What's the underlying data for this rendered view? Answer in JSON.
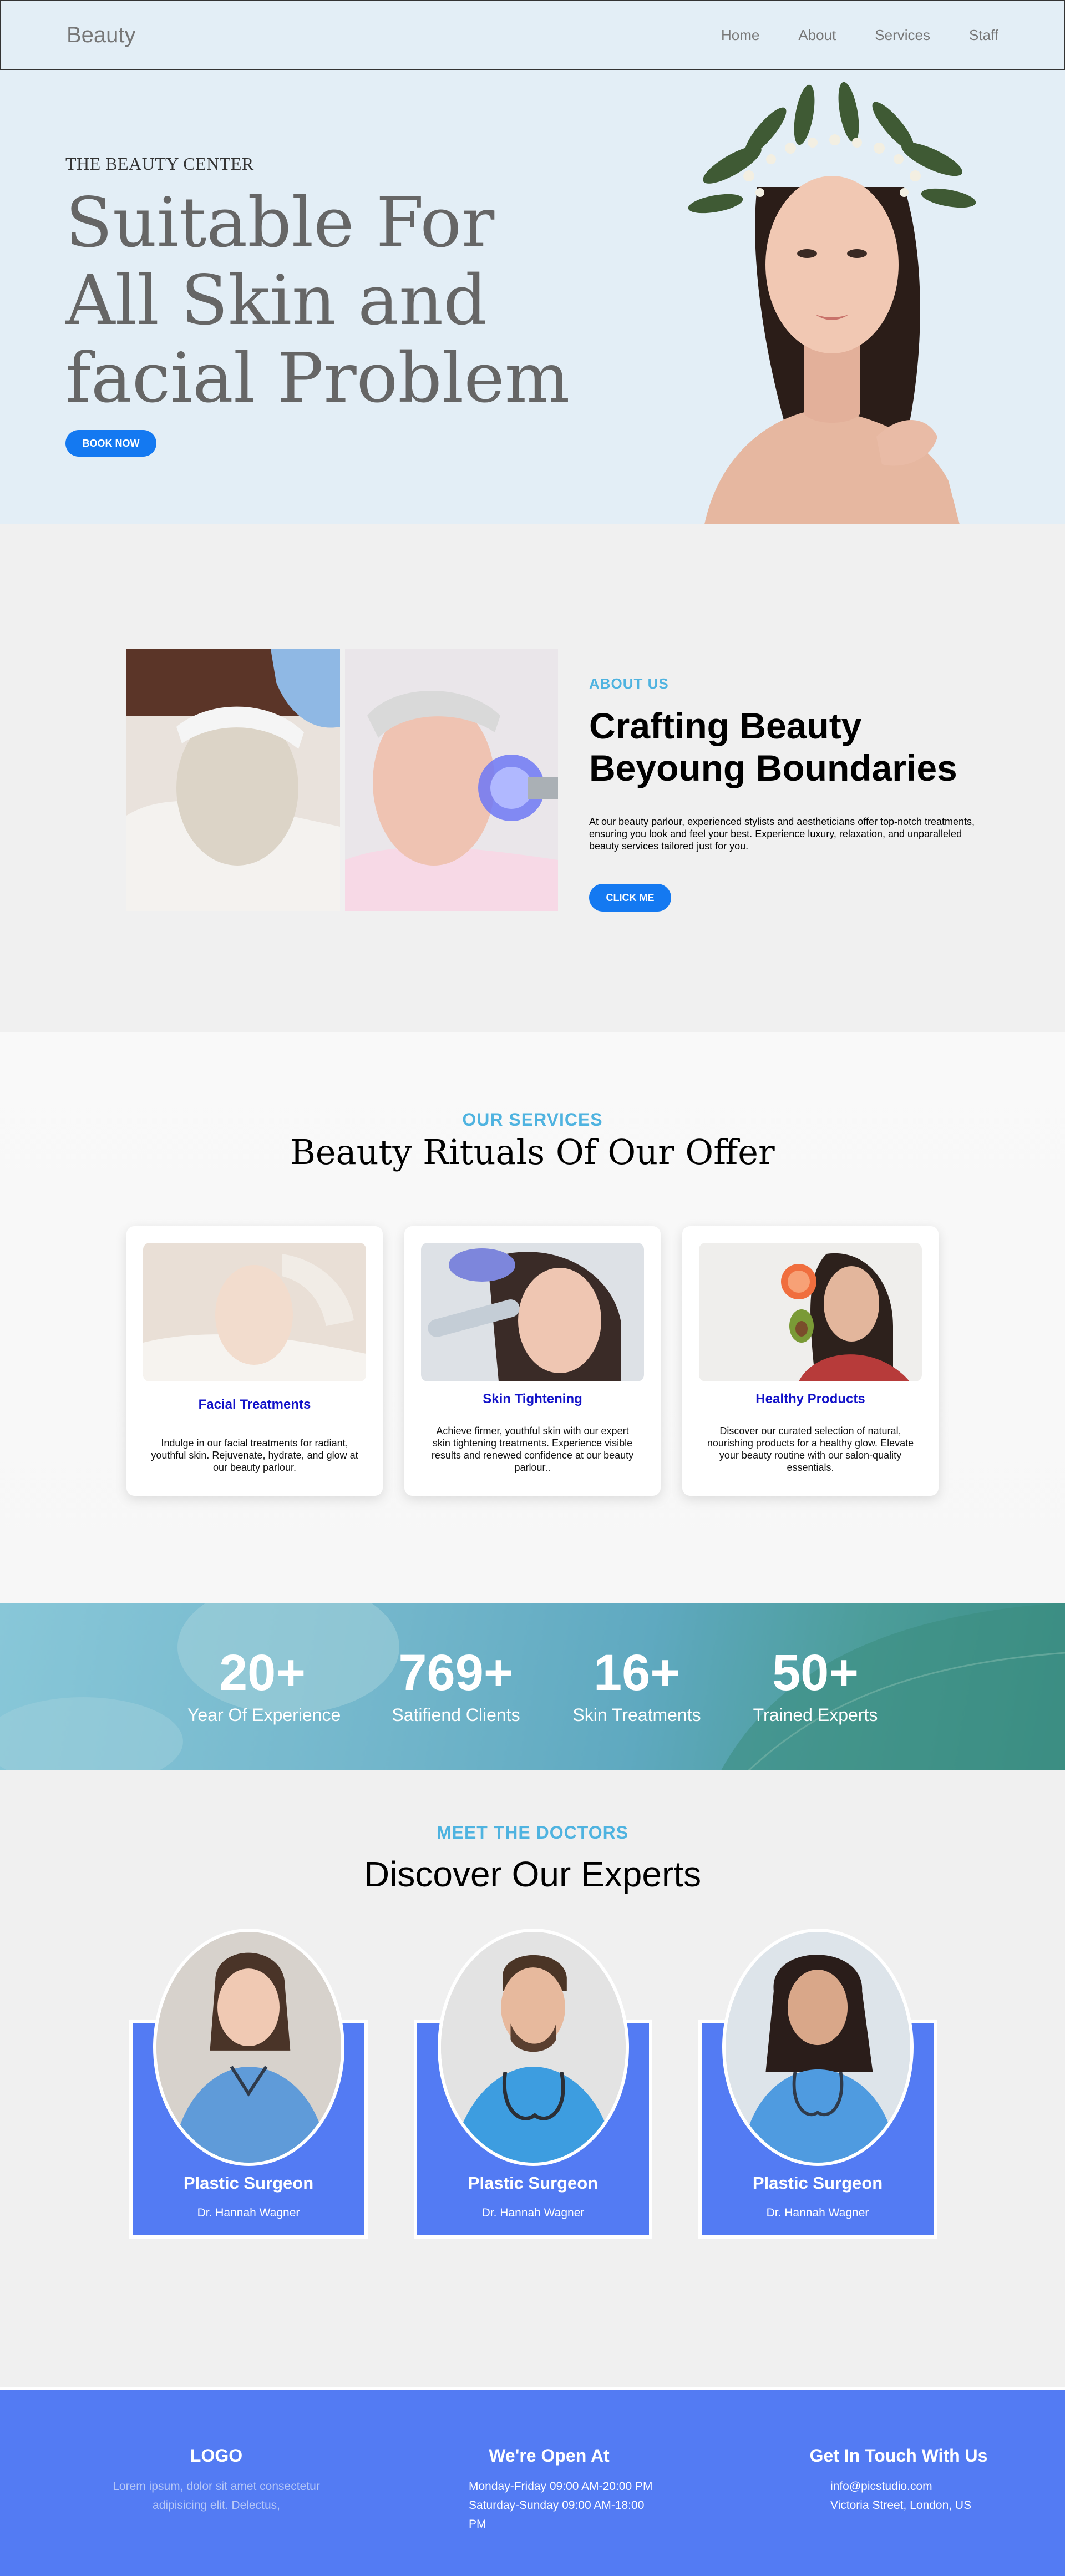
{
  "nav": {
    "brand": "Beauty",
    "links": [
      "Home",
      "About",
      "Services",
      "Staff"
    ]
  },
  "hero": {
    "kicker": "THE BEAUTY CENTER",
    "title": "Suitable For All Skin and facial Problem",
    "cta": "BOOK NOW"
  },
  "about": {
    "label": "ABOUT US",
    "title": "Crafting Beauty Beyoung Boundaries",
    "text": "At our beauty parlour, experienced stylists and aestheticians offer top-notch treatments, ensuring you look and feel your best. Experience luxury, relaxation, and unparalleled beauty services tailored just for you.",
    "cta": "CLICK ME"
  },
  "services": {
    "label": "OUR SERVICES",
    "title": "Beauty Rituals Of Our Offer",
    "cards": [
      {
        "title": "Facial Treatments",
        "text": "Indulge in our facial treatments for radiant, youthful skin. Rejuvenate, hydrate, and glow at our beauty parlour."
      },
      {
        "title": "Skin Tightening",
        "text": "Achieve firmer, youthful skin with our expert skin tightening treatments. Experience visible results and renewed confidence at our beauty parlour.."
      },
      {
        "title": "Healthy Products",
        "text": "Discover our curated selection of natural, nourishing products for a healthy glow. Elevate your beauty routine with our salon-quality essentials."
      }
    ]
  },
  "stats": [
    {
      "value": "20+",
      "caption": "Year Of Experience"
    },
    {
      "value": "769+",
      "caption": "Satifiend Clients"
    },
    {
      "value": "16+",
      "caption": "Skin Treatments"
    },
    {
      "value": "50+",
      "caption": "Trained Experts"
    }
  ],
  "doctors": {
    "label": "MEET THE DOCTORS",
    "title": "Discover Our Experts",
    "cards": [
      {
        "role": "Plastic Surgeon",
        "name": "Dr. Hannah Wagner"
      },
      {
        "role": "Plastic Surgeon",
        "name": "Dr. Hannah Wagner"
      },
      {
        "role": "Plastic Surgeon",
        "name": "Dr. Hannah Wagner"
      }
    ]
  },
  "footer": {
    "logo": {
      "title": "LOGO",
      "line1": "Lorem ipsum, dolor sit amet consectetur",
      "line2": "adipisicing elit. Delectus,"
    },
    "hours": {
      "title": "We're Open At",
      "line1": "Monday-Friday 09:00 AM-20:00 PM",
      "line2": "Saturday-Sunday 09:00 AM-18:00 PM"
    },
    "contact": {
      "title": "Get In Touch With Us",
      "line1": "info@picstudio.com",
      "line2": "Victoria Street, London, US"
    }
  }
}
